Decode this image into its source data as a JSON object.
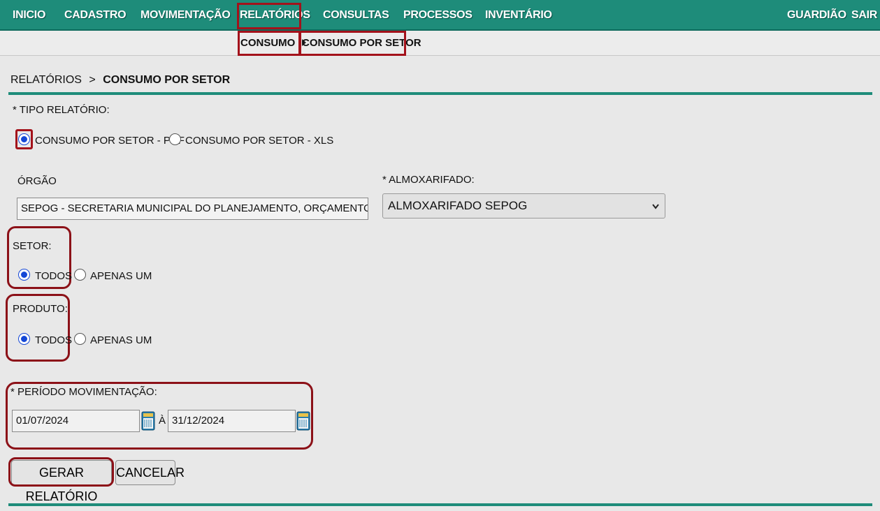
{
  "nav": {
    "items": [
      "INICIO",
      "CADASTRO",
      "MOVIMENTAÇÃO",
      "RELATÓRIOS",
      "CONSULTAS",
      "PROCESSOS",
      "INVENTÁRIO"
    ],
    "user": "GUARDIÃO",
    "logout": "SAIR"
  },
  "subnav": {
    "consumo": "CONSUMO",
    "consumo_por_setor": "CONSUMO POR SETOR"
  },
  "breadcrumb": {
    "parent": "RELATÓRIOS",
    "separator": ">",
    "current": "CONSUMO POR SETOR"
  },
  "form": {
    "tipo_label": "* TIPO RELATÓRIO:",
    "tipo_options": [
      "CONSUMO POR SETOR - PDF",
      "CONSUMO POR SETOR - XLS"
    ],
    "tipo_selected": "CONSUMO POR SETOR - PDF",
    "orgao_label": "ÓRGÃO",
    "orgao_value": "SEPOG - SECRETARIA MUNICIPAL DO PLANEJAMENTO, ORÇAMENTO E GESTÃO",
    "almox_label": "* ALMOXARIFADO:",
    "almox_value": "ALMOXARIFADO SEPOG",
    "setor_label": "SETOR:",
    "setor_options": [
      "TODOS",
      "APENAS UM"
    ],
    "setor_selected": "TODOS",
    "produto_label": "PRODUTO:",
    "produto_options": [
      "TODOS",
      "APENAS UM"
    ],
    "produto_selected": "TODOS",
    "periodo_label": "* PERÍODO MOVIMENTAÇÃO:",
    "periodo_inicio": "01/07/2024",
    "periodo_sep": "À",
    "periodo_fim": "31/12/2024",
    "gerar_label": "GERAR RELATÓRIO",
    "cancelar_label": "CANCELAR"
  },
  "colors": {
    "header_teal": "#1e8c7a",
    "highlight_red": "#a3121b",
    "radio_blue": "#1447d6"
  }
}
